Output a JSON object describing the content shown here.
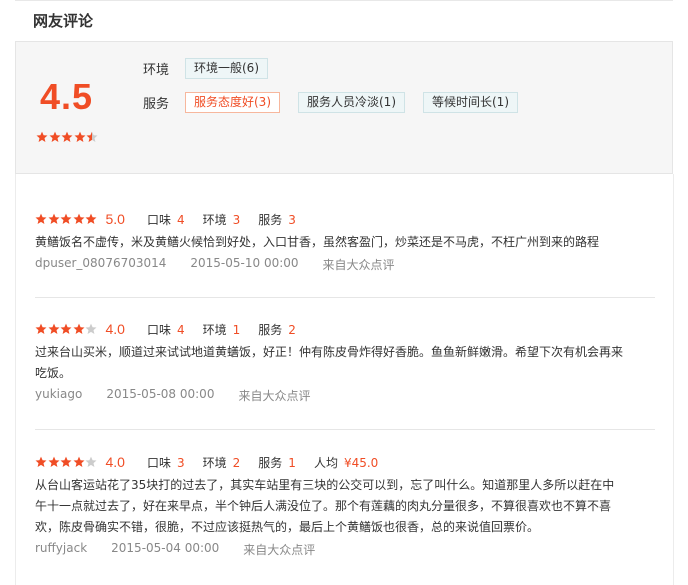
{
  "section_title": "网友评论",
  "colors": {
    "accent": "#f04d25",
    "tag_bg": "#eef6f7",
    "muted": "#888888"
  },
  "summary": {
    "score": "4.5",
    "rating_stars": 4.5,
    "row1": {
      "label": "环境",
      "tags": [
        {
          "text": "环境一般(6)",
          "hot": false
        }
      ]
    },
    "row2": {
      "label": "服务",
      "tags": [
        {
          "text": "服务态度好(3)",
          "hot": true
        },
        {
          "text": "服务人员冷淡(1)",
          "hot": false
        },
        {
          "text": "等候时间长(1)",
          "hot": false
        }
      ]
    }
  },
  "reviews": [
    {
      "stars": 5,
      "score": "5.0",
      "subs": [
        {
          "label": "口味",
          "value": "4"
        },
        {
          "label": "环境",
          "value": "3"
        },
        {
          "label": "服务",
          "value": "3"
        }
      ],
      "text": "黄鳝饭名不虚传，米及黄鳝火候恰到好处，入口甘香，虽然客盈门，炒菜还是不马虎，不枉广州到来的路程",
      "user": "dpuser_08076703014",
      "date": "2015-05-10 00:00",
      "source": "来自大众点评"
    },
    {
      "stars": 4,
      "score": "4.0",
      "subs": [
        {
          "label": "口味",
          "value": "4"
        },
        {
          "label": "环境",
          "value": "1"
        },
        {
          "label": "服务",
          "value": "2"
        }
      ],
      "text": "过来台山买米，顺道过来试试地道黄蟮饭，好正！仲有陈皮骨炸得好香脆。鱼鱼新鲜嫩滑。希望下次有机会再来吃饭。",
      "user": "yukiago",
      "date": "2015-05-08 00:00",
      "source": "来自大众点评"
    },
    {
      "stars": 4,
      "score": "4.0",
      "subs": [
        {
          "label": "口味",
          "value": "3"
        },
        {
          "label": "环境",
          "value": "2"
        },
        {
          "label": "服务",
          "value": "1"
        },
        {
          "label": "人均",
          "value": "¥45.0"
        }
      ],
      "text": "从台山客运站花了35块打的过去了，其实车站里有三块的公交可以到，忘了叫什么。知道那里人多所以赶在中午十一点就过去了，好在来早点，半个钟后人满没位了。那个有莲藕的肉丸分量很多，不算很喜欢也不算不喜欢，陈皮骨确实不错，很脆，不过应该挺热气的，最后上个黄鳝饭也很香，总的来说值回票价。",
      "user": "ruffyjack",
      "date": "2015-05-04 00:00",
      "source": "来自大众点评"
    }
  ]
}
